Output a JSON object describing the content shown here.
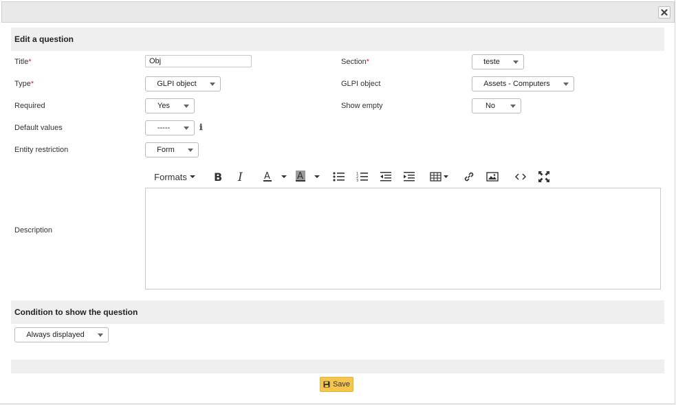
{
  "section_edit": {
    "title": "Edit a question"
  },
  "fields": {
    "title_label": "Title",
    "title_value": "Obj",
    "section_label": "Section",
    "section_value": "teste",
    "type_label": "Type",
    "type_value": "GLPI object",
    "glpi_object_label": "GLPI object",
    "glpi_object_value": "Assets - Computers",
    "required_label": "Required",
    "required_value": "Yes",
    "show_empty_label": "Show empty",
    "show_empty_value": "No",
    "default_values_label": "Default values",
    "default_values_value": "-----",
    "entity_restriction_label": "Entity restriction",
    "entity_restriction_value": "Form",
    "description_label": "Description",
    "required_marker": "*"
  },
  "editor_toolbar": {
    "formats_label": "Formats",
    "icons": [
      "bold-icon",
      "italic-icon",
      "text-color-icon",
      "background-color-icon",
      "bullet-list-icon",
      "numbered-list-icon",
      "outdent-icon",
      "indent-icon",
      "table-icon",
      "link-icon",
      "image-icon",
      "source-code-icon",
      "fullscreen-icon"
    ]
  },
  "section_condition": {
    "title": "Condition to show the question",
    "value": "Always displayed"
  },
  "footer": {
    "save_label": "Save"
  },
  "colors": {
    "accent": "#f5c64f",
    "required": "#dd2222",
    "header_bg": "#efefef"
  }
}
